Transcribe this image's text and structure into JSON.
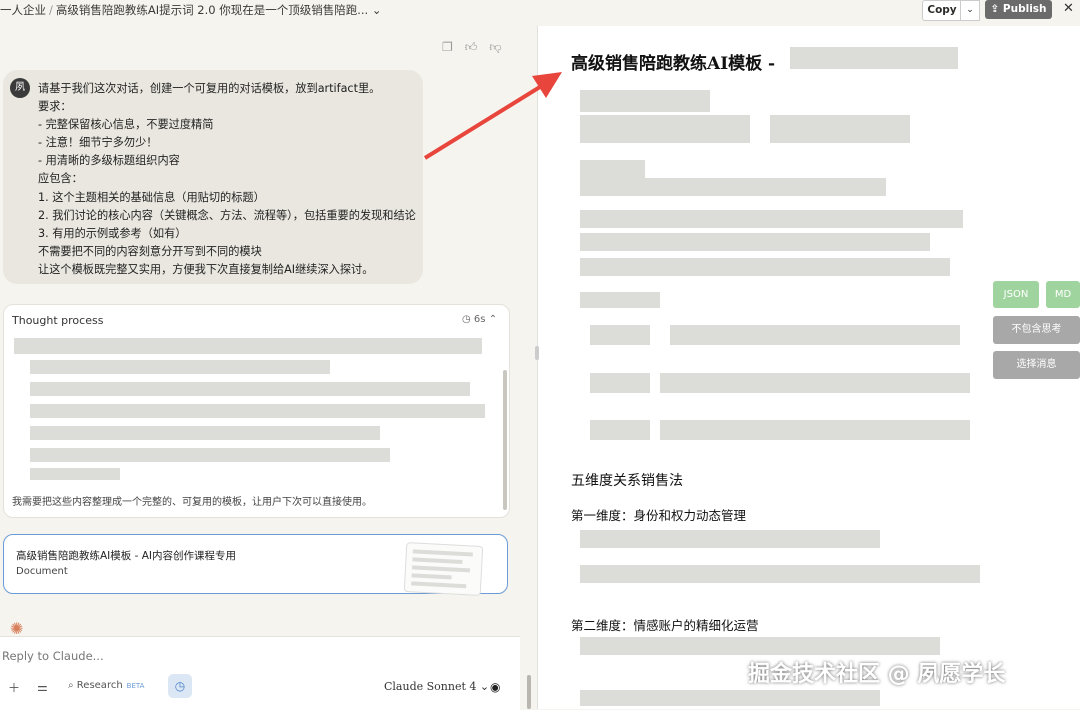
{
  "breadcrumb": {
    "project": "一人企业",
    "separator": "/",
    "chat_title": "高级销售陪跑教练AI提示词 2.0 你现在是一个顶级销售陪跑..."
  },
  "user_message": {
    "avatar_initial": "夙",
    "lines": [
      "请基于我们这次对话，创建一个可复用的对话模板，放到artifact里。",
      "要求：",
      "- 完整保留核心信息，不要过度精简",
      "- 注意！细节宁多勿少！",
      "- 用清晰的多级标题组织内容",
      "应包含：",
      "1. 这个主题相关的基础信息（用贴切的标题）",
      "2. 我们讨论的核心内容（关键概念、方法、流程等），包括重要的发现和结论",
      "3. 有用的示例或参考（如有）",
      "不需要把不同的内容刻意分开写到不同的模块",
      "让这个模板既完整又实用，方便我下次直接复制给AI继续深入探讨。"
    ]
  },
  "thought": {
    "title": "Thought process",
    "duration": "6s",
    "footer": "我需要把这些内容整理成一个完整的、可复用的模板，让用户下次可以直接使用。"
  },
  "document_card": {
    "title": "高级销售陪跑教练AI模板 - AI内容创作课程专用",
    "type": "Document"
  },
  "composer": {
    "placeholder": "Reply to Claude...",
    "research_label": "Research",
    "beta_label": "BETA",
    "model": "Claude Sonnet 4"
  },
  "artifact": {
    "copy_label": "Copy",
    "publish_label": "Publish",
    "heading": "高级销售陪跑教练AI模板 -",
    "section": "五维度关系销售法",
    "dimension1": "第一维度：身份和权力动态管理",
    "dimension2": "第二维度：情感账户的精细化运营"
  },
  "side_tools": {
    "json": "JSON",
    "md": "MD",
    "no_thinking": "不包含思考",
    "select_message": "选择消息"
  },
  "watermark": "掘金技术社区 @ 夙愿学长",
  "colors": {
    "accent_blue": "#6b9bd6",
    "green_btn": "#9fd49f",
    "arrow_red": "#e8453c"
  }
}
